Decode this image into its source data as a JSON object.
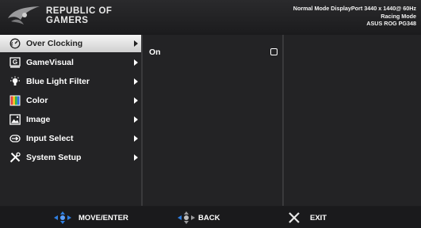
{
  "header": {
    "brand_line1": "REPUBLIC OF",
    "brand_line2": "GAMERS",
    "status_line1": "Normal Mode DisplayPort 3440 x 1440@ 60Hz",
    "status_line2": "Racing Mode",
    "status_line3": "ASUS ROG PG348"
  },
  "menu": {
    "items": [
      {
        "label": "Over Clocking",
        "icon": "speedometer-icon",
        "selected": true
      },
      {
        "label": "GameVisual",
        "icon": "gamevisual-icon"
      },
      {
        "label": "Blue Light Filter",
        "icon": "lightbulb-icon"
      },
      {
        "label": "Color",
        "icon": "color-icon"
      },
      {
        "label": "Image",
        "icon": "image-icon"
      },
      {
        "label": "Input Select",
        "icon": "input-select-icon"
      },
      {
        "label": "System Setup",
        "icon": "system-setup-icon"
      }
    ]
  },
  "submenu": {
    "options": [
      {
        "label": "On",
        "checked": false
      }
    ]
  },
  "footer": {
    "move_enter_label": "MOVE/ENTER",
    "back_label": "BACK",
    "exit_label": "EXIT"
  },
  "colors": {
    "background": "#1b1b1d",
    "selected_bg": "#e6e6e6",
    "accent_blue": "#2e7ee0"
  }
}
